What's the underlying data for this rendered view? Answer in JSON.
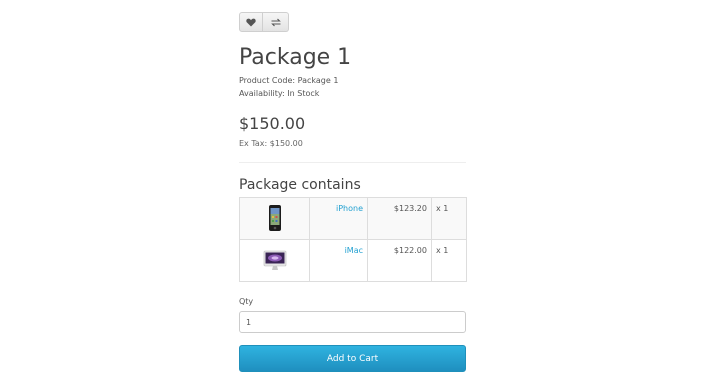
{
  "product": {
    "title": "Package 1",
    "product_code": "Product Code: Package 1",
    "availability": "Availability: In Stock",
    "price": "$150.00",
    "ex_tax": "Ex Tax: $150.00"
  },
  "actions": {
    "wishlist_icon": "heart-icon",
    "compare_icon": "exchange-icon"
  },
  "package": {
    "heading": "Package contains",
    "items": [
      {
        "name": "iPhone",
        "price": "$123.20",
        "qty": "x 1",
        "thumb_icon": "iphone-thumbnail"
      },
      {
        "name": "iMac",
        "price": "$122.00",
        "qty": "x 1",
        "thumb_icon": "imac-thumbnail"
      }
    ]
  },
  "form": {
    "qty_label": "Qty",
    "qty_value": "1",
    "add_to_cart_label": "Add to Cart"
  },
  "colors": {
    "link": "#23a1d1",
    "button": "#1f8fbf"
  }
}
